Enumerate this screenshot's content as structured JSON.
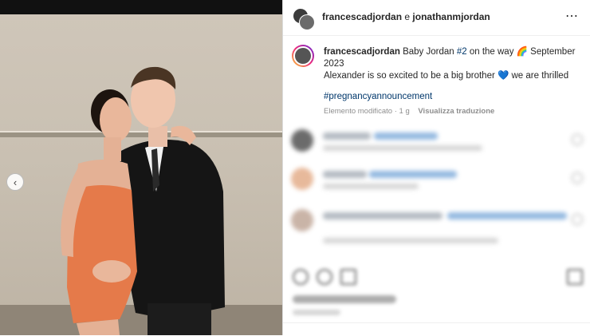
{
  "post_header": {
    "user1": "francescadjordan",
    "conjunction": "e",
    "user2": "jonathanmjordan",
    "more_icon": "⋯"
  },
  "caption": {
    "username": "francescadjordan",
    "text_part1": " Baby Jordan ",
    "hashtag_inline": "#2",
    "text_part2": " on the way 🌈 September 2023",
    "line2": "Alexander is so excited to be a big brother 💙 we are thrilled",
    "hashtag": "#pregnancyannouncement"
  },
  "meta": {
    "edited": "Elemento modificato",
    "separator": " · ",
    "time": "1 g",
    "translate": "Visualizza traduzione"
  },
  "carousel": {
    "prev_icon": "‹"
  },
  "colors": {
    "link": "#00376b",
    "text": "#262626",
    "muted": "#8e8e8e"
  }
}
